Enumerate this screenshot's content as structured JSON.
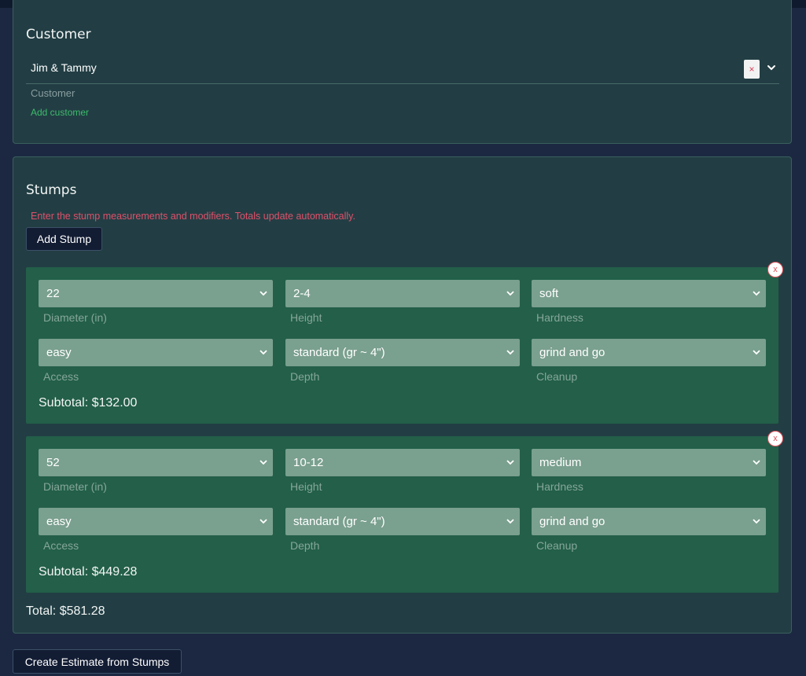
{
  "customer": {
    "title": "Customer",
    "selected": "Jim & Tammy",
    "clear_glyph": "×",
    "helper": "Customer",
    "add_link": "Add customer"
  },
  "stumps": {
    "title": "Stumps",
    "description": "Enter the stump measurements and modifiers. Totals update automatically.",
    "add_button": "Add Stump",
    "remove_glyph": "x",
    "items": [
      {
        "diameter": "22",
        "diameter_label": "Diameter (in)",
        "height": "2-4",
        "height_label": "Height",
        "hardness": "soft",
        "hardness_label": "Hardness",
        "access": "easy",
        "access_label": "Access",
        "depth": "standard (gr ~ 4\")",
        "depth_label": "Depth",
        "cleanup": "grind and go",
        "cleanup_label": "Cleanup",
        "subtotal": "Subtotal: $132.00"
      },
      {
        "diameter": "52",
        "diameter_label": "Diameter (in)",
        "height": "10-12",
        "height_label": "Height",
        "hardness": "medium",
        "hardness_label": "Hardness",
        "access": "easy",
        "access_label": "Access",
        "depth": "standard (gr ~ 4\")",
        "depth_label": "Depth",
        "cleanup": "grind and go",
        "cleanup_label": "Cleanup",
        "subtotal": "Subtotal: $449.28"
      }
    ],
    "total": "Total: $581.28"
  },
  "actions": {
    "create_estimate": "Create Estimate from Stumps"
  },
  "colors": {
    "background": "#1c2841",
    "card": "#223e44",
    "stump_card": "#235f49",
    "select": "#7aa08f",
    "accent_link": "#3dbb6b",
    "error_text": "#e0506a"
  },
  "icons": {
    "dropdown": "chevron-down-icon",
    "clear": "close-icon",
    "remove": "remove-circle-icon"
  }
}
